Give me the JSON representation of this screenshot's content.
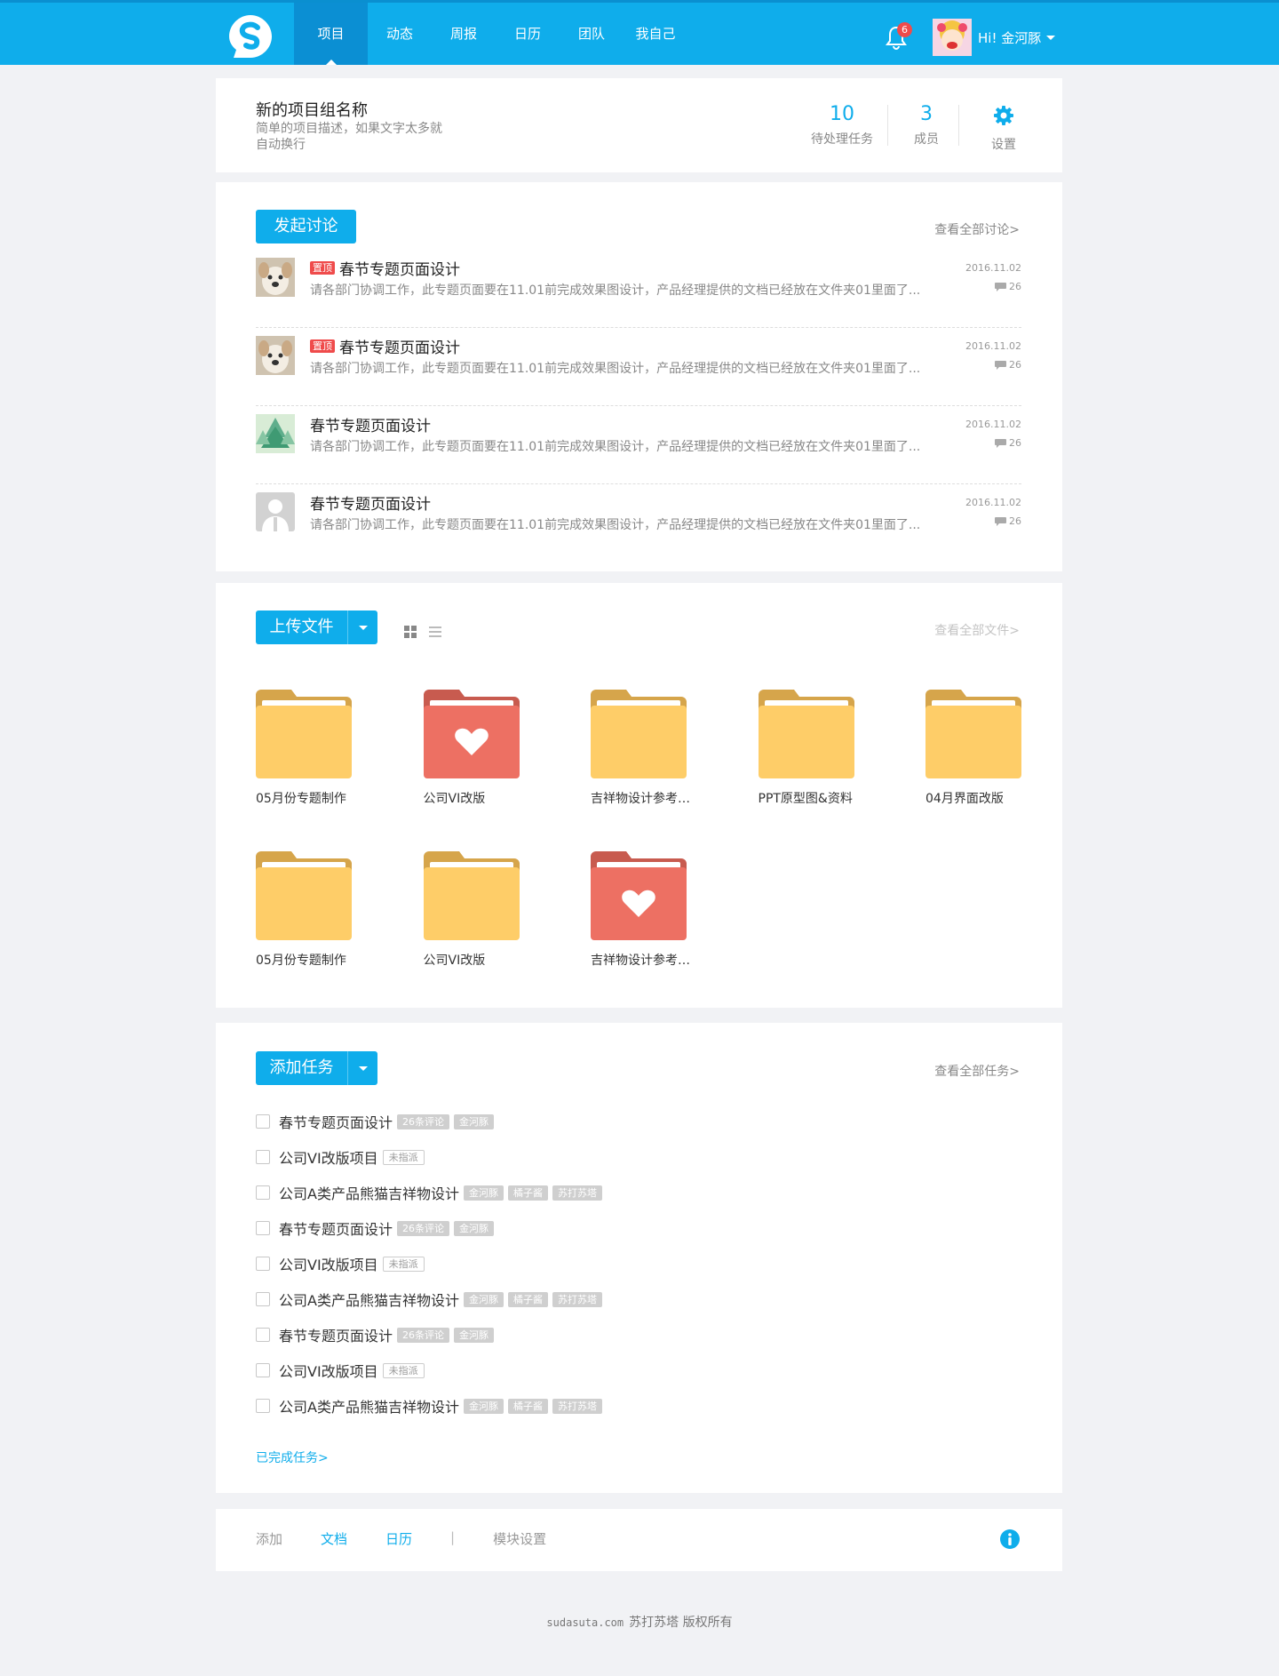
{
  "header": {
    "nav": [
      "项目",
      "动态",
      "周报",
      "日历",
      "团队",
      "我自己"
    ],
    "notification_count": "6",
    "user_greeting": "Hi! 金河豚",
    "accent_color": "#0fadeb"
  },
  "project": {
    "title": "新的项目组名称",
    "description": "简单的项目描述，如果文字太多就自动换行",
    "pending_tasks": {
      "value": "10",
      "label": "待处理任务"
    },
    "members": {
      "value": "3",
      "label": "成员"
    },
    "settings_label": "设置"
  },
  "discussion": {
    "button": "发起讨论",
    "view_all": "查看全部讨论>",
    "pinned_label": "置顶",
    "items": [
      {
        "pinned": true,
        "title": "春节专题页面设计",
        "text": "请各部门协调工作，此专题页面要在11.01前完成效果图设计，产品经理提供的文档已经放在文件夹01里面了...",
        "date": "2016.11.02",
        "comments": "26",
        "avatar": "dog"
      },
      {
        "pinned": true,
        "title": "春节专题页面设计",
        "text": "请各部门协调工作，此专题页面要在11.01前完成效果图设计，产品经理提供的文档已经放在文件夹01里面了...",
        "date": "2016.11.02",
        "comments": "26",
        "avatar": "dog"
      },
      {
        "pinned": false,
        "title": "春节专题页面设计",
        "text": "请各部门协调工作，此专题页面要在11.01前完成效果图设计，产品经理提供的文档已经放在文件夹01里面了...",
        "date": "2016.11.02",
        "comments": "26",
        "avatar": "tree"
      },
      {
        "pinned": false,
        "title": "春节专题页面设计",
        "text": "请各部门协调工作，此专题页面要在11.01前完成效果图设计，产品经理提供的文档已经放在文件夹01里面了...",
        "date": "2016.11.02",
        "comments": "26",
        "avatar": "default"
      }
    ]
  },
  "files": {
    "button": "上传文件",
    "view_all": "查看全部文件>",
    "folders": [
      {
        "name": "05月份专题制作",
        "style": "yellow"
      },
      {
        "name": "公司VI改版",
        "style": "red-heart"
      },
      {
        "name": "吉祥物设计参考…",
        "style": "yellow"
      },
      {
        "name": "PPT原型图&资料",
        "style": "yellow"
      },
      {
        "name": "04月界面改版",
        "style": "yellow"
      },
      {
        "name": "05月份专题制作",
        "style": "yellow"
      },
      {
        "name": "公司VI改版",
        "style": "yellow"
      },
      {
        "name": "吉祥物设计参考…",
        "style": "red-heart"
      }
    ]
  },
  "tasks": {
    "button": "添加任务",
    "view_all": "查看全部任务>",
    "items": [
      {
        "title": "春节专题页面设计",
        "tags": [
          "26条评论",
          "金河豚"
        ],
        "outline": false
      },
      {
        "title": "公司VI改版项目",
        "tags": [
          "未指派"
        ],
        "outline": true
      },
      {
        "title": "公司A类产品熊猫吉祥物设计",
        "tags": [
          "金河豚",
          "橘子酱",
          "苏打苏塔"
        ],
        "outline": false
      },
      {
        "title": "春节专题页面设计",
        "tags": [
          "26条评论",
          "金河豚"
        ],
        "outline": false
      },
      {
        "title": "公司VI改版项目",
        "tags": [
          "未指派"
        ],
        "outline": true
      },
      {
        "title": "公司A类产品熊猫吉祥物设计",
        "tags": [
          "金河豚",
          "橘子酱",
          "苏打苏塔"
        ],
        "outline": false
      },
      {
        "title": "春节专题页面设计",
        "tags": [
          "26条评论",
          "金河豚"
        ],
        "outline": false
      },
      {
        "title": "公司VI改版项目",
        "tags": [
          "未指派"
        ],
        "outline": true
      },
      {
        "title": "公司A类产品熊猫吉祥物设计",
        "tags": [
          "金河豚",
          "橘子酱",
          "苏打苏塔"
        ],
        "outline": false
      }
    ],
    "completed_link": "已完成任务>"
  },
  "bottom_bar": {
    "add": "添加",
    "docs": "文档",
    "calendar": "日历",
    "separator": "|",
    "module_settings": "模块设置"
  },
  "footer": {
    "domain": "sudasuta.com",
    "text": "苏打苏塔 版权所有"
  }
}
